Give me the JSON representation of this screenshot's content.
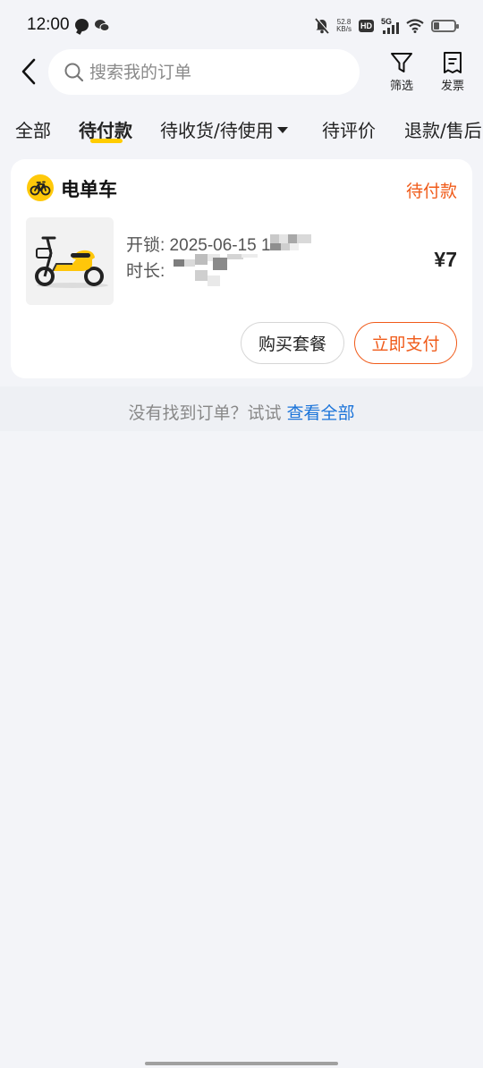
{
  "status_bar": {
    "time": "12:00",
    "net_speed_value": "52.8",
    "net_speed_unit": "KB/s",
    "hd_label": "HD",
    "signal_label": "5G",
    "icons": [
      "message-icon",
      "wechat-icon",
      "mute-bell-icon",
      "wifi-icon",
      "battery-icon"
    ]
  },
  "header": {
    "search_placeholder": "搜索我的订单",
    "filter_label": "筛选",
    "invoice_label": "发票"
  },
  "tabs": [
    {
      "label": "全部",
      "active": false
    },
    {
      "label": "待付款",
      "active": true
    },
    {
      "label": "待收货/待使用",
      "active": false,
      "has_dropdown": true
    },
    {
      "label": "待评价",
      "active": false
    },
    {
      "label": "退款/售后",
      "active": false
    }
  ],
  "order": {
    "business": "电单车",
    "status": "待付款",
    "unlock_text": "开锁: 2025-06-15 1",
    "duration_text": "时长:",
    "price": "¥7",
    "buttons": {
      "buy_package": "购买套餐",
      "pay_now": "立即支付"
    }
  },
  "hint": {
    "text": "没有找到订单？试试 ",
    "link": "查看全部"
  },
  "colors": {
    "accent_yellow": "#ffcc00",
    "status_orange": "#f05b1a",
    "link_blue": "#1a73d9",
    "background": "#f3f4f8"
  }
}
